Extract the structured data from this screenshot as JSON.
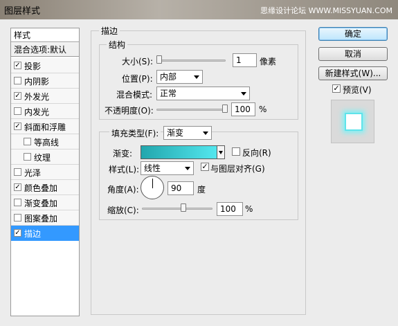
{
  "window": {
    "title": "图层样式",
    "watermark": "思缘设计论坛 WWW.MISSYUAN.COM"
  },
  "left_panel": {
    "header": "样式",
    "blend_defaults": "混合选项:默认",
    "items": [
      {
        "label": "投影",
        "checked": true
      },
      {
        "label": "内阴影",
        "checked": false
      },
      {
        "label": "外发光",
        "checked": true
      },
      {
        "label": "内发光",
        "checked": false
      },
      {
        "label": "斜面和浮雕",
        "checked": true
      },
      {
        "label": "等高线",
        "checked": false
      },
      {
        "label": "纹理",
        "checked": false
      },
      {
        "label": "光泽",
        "checked": false
      },
      {
        "label": "颜色叠加",
        "checked": true
      },
      {
        "label": "渐变叠加",
        "checked": false
      },
      {
        "label": "图案叠加",
        "checked": false
      },
      {
        "label": "描边",
        "checked": true,
        "selected": true
      }
    ]
  },
  "stroke": {
    "title": "描边",
    "structure": {
      "legend": "结构",
      "size_label": "大小(S):",
      "size_value": "1",
      "size_unit": "像素",
      "size_level": 0.0,
      "position_label": "位置(P):",
      "position_value": "内部",
      "blend_label": "混合模式:",
      "blend_value": "正常",
      "opacity_label": "不透明度(O):",
      "opacity_value": "100",
      "opacity_unit": "%",
      "opacity_level": 1.0
    },
    "fill": {
      "fill_type_label": "填充类型(F):",
      "fill_type_value": "渐变",
      "gradient_label": "渐变:",
      "gradient_start_color": "#22a6ad",
      "gradient_end_color": "#53e7ee",
      "reverse_label": "反向(R)",
      "reverse_checked": false,
      "style_label": "样式(L):",
      "style_value": "线性",
      "align_label": "与图层对齐(G)",
      "align_checked": true,
      "angle_label": "角度(A):",
      "angle_value": "90",
      "angle_unit": "度",
      "scale_label": "缩放(C):",
      "scale_value": "100",
      "scale_unit": "%",
      "scale_level": 0.6
    }
  },
  "buttons": {
    "ok": "确定",
    "cancel": "取消",
    "new_style": "新建样式(W)...",
    "preview_label": "预览(V)",
    "preview_checked": true
  }
}
